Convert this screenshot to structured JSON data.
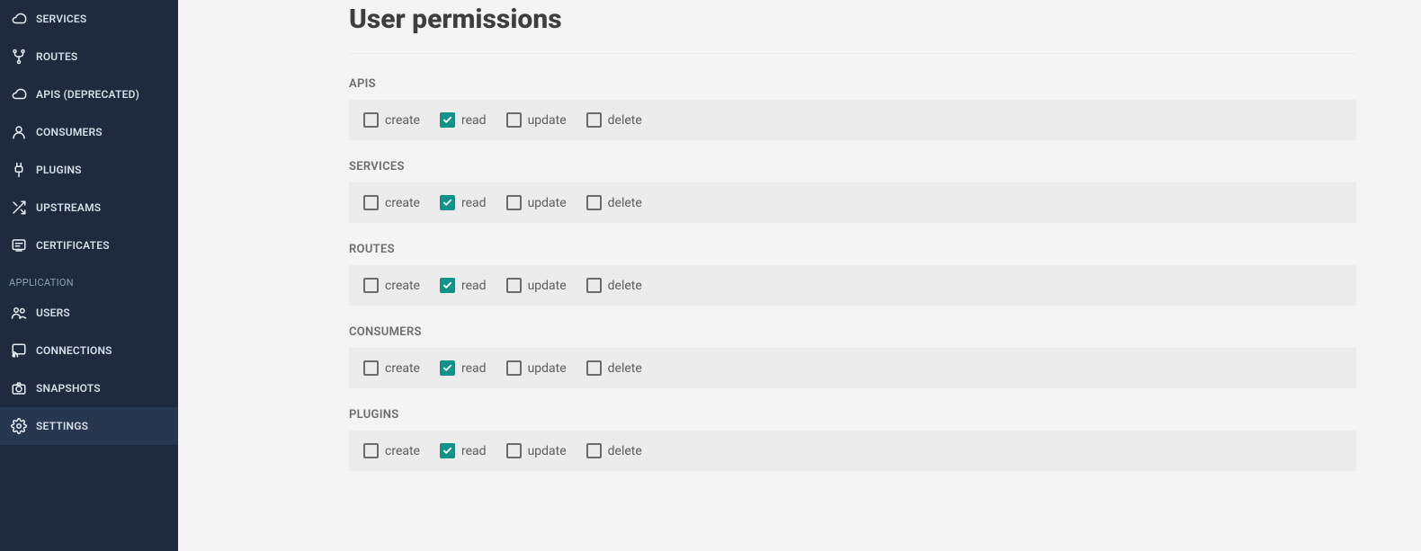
{
  "sidebar": {
    "nav": [
      {
        "label": "SERVICES",
        "icon": "cloud"
      },
      {
        "label": "ROUTES",
        "icon": "fork"
      },
      {
        "label": "APIS (DEPRECATED)",
        "icon": "cloud"
      },
      {
        "label": "CONSUMERS",
        "icon": "person"
      },
      {
        "label": "PLUGINS",
        "icon": "plug"
      },
      {
        "label": "UPSTREAMS",
        "icon": "shuffle"
      },
      {
        "label": "CERTIFICATES",
        "icon": "cert"
      }
    ],
    "app_heading": "APPLICATION",
    "app": [
      {
        "label": "USERS",
        "icon": "users"
      },
      {
        "label": "CONNECTIONS",
        "icon": "cast"
      },
      {
        "label": "SNAPSHOTS",
        "icon": "camera"
      },
      {
        "label": "SETTINGS",
        "icon": "gear",
        "active": true
      }
    ]
  },
  "page": {
    "title": "User permissions",
    "sections": [
      {
        "name": "APIS",
        "perms": [
          {
            "label": "create",
            "checked": false
          },
          {
            "label": "read",
            "checked": true
          },
          {
            "label": "update",
            "checked": false
          },
          {
            "label": "delete",
            "checked": false
          }
        ]
      },
      {
        "name": "SERVICES",
        "perms": [
          {
            "label": "create",
            "checked": false
          },
          {
            "label": "read",
            "checked": true
          },
          {
            "label": "update",
            "checked": false
          },
          {
            "label": "delete",
            "checked": false
          }
        ]
      },
      {
        "name": "ROUTES",
        "perms": [
          {
            "label": "create",
            "checked": false
          },
          {
            "label": "read",
            "checked": true
          },
          {
            "label": "update",
            "checked": false
          },
          {
            "label": "delete",
            "checked": false
          }
        ]
      },
      {
        "name": "CONSUMERS",
        "perms": [
          {
            "label": "create",
            "checked": false
          },
          {
            "label": "read",
            "checked": true
          },
          {
            "label": "update",
            "checked": false
          },
          {
            "label": "delete",
            "checked": false
          }
        ]
      },
      {
        "name": "PLUGINS",
        "perms": [
          {
            "label": "create",
            "checked": false
          },
          {
            "label": "read",
            "checked": true
          },
          {
            "label": "update",
            "checked": false
          },
          {
            "label": "delete",
            "checked": false
          }
        ]
      }
    ]
  }
}
